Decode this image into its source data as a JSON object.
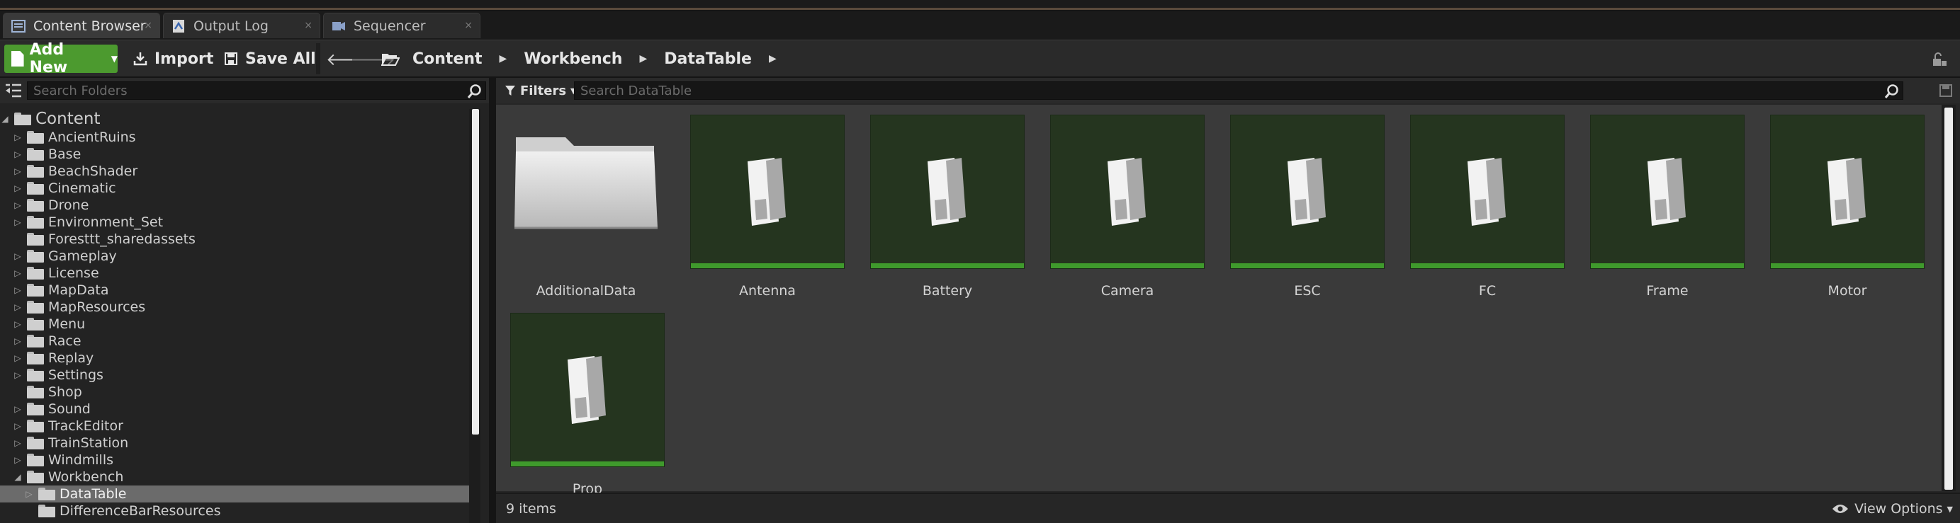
{
  "tabs": [
    {
      "label": "Content Browser",
      "active": true,
      "icon": "content-browser-icon"
    },
    {
      "label": "Output Log",
      "active": false,
      "icon": "output-log-icon"
    },
    {
      "label": "Sequencer",
      "active": false,
      "icon": "sequencer-icon"
    }
  ],
  "toolbar": {
    "add_new_label": "Add New",
    "import_label": "Import",
    "save_all_label": "Save All"
  },
  "breadcrumbs": [
    "Content",
    "Workbench",
    "DataTable"
  ],
  "folder_search": {
    "placeholder": "Search Folders"
  },
  "tree": {
    "root": "Content",
    "items": [
      {
        "label": "AncientRuins",
        "expandable": true
      },
      {
        "label": "Base",
        "expandable": true
      },
      {
        "label": "BeachShader",
        "expandable": true
      },
      {
        "label": "Cinematic",
        "expandable": true
      },
      {
        "label": "Drone",
        "expandable": true
      },
      {
        "label": "Environment_Set",
        "expandable": true
      },
      {
        "label": "Foresttt_sharedassets",
        "expandable": false
      },
      {
        "label": "Gameplay",
        "expandable": true
      },
      {
        "label": "License",
        "expandable": true
      },
      {
        "label": "MapData",
        "expandable": true
      },
      {
        "label": "MapResources",
        "expandable": true
      },
      {
        "label": "Menu",
        "expandable": true
      },
      {
        "label": "Race",
        "expandable": true
      },
      {
        "label": "Replay",
        "expandable": true
      },
      {
        "label": "Settings",
        "expandable": true
      },
      {
        "label": "Shop",
        "expandable": false
      },
      {
        "label": "Sound",
        "expandable": true
      },
      {
        "label": "TrackEditor",
        "expandable": true
      },
      {
        "label": "TrainStation",
        "expandable": true
      },
      {
        "label": "Windmills",
        "expandable": true
      },
      {
        "label": "Workbench",
        "expandable": true,
        "expanded": true
      }
    ],
    "children": [
      {
        "label": "DataTable",
        "expandable": true,
        "selected": true
      },
      {
        "label": "DifferenceBarResources",
        "expandable": false
      }
    ]
  },
  "filters_label": "Filters",
  "asset_search": {
    "placeholder": "Search DataTable"
  },
  "assets": [
    {
      "label": "AdditionalData",
      "kind": "folder"
    },
    {
      "label": "Antenna",
      "kind": "datatable"
    },
    {
      "label": "Battery",
      "kind": "datatable"
    },
    {
      "label": "Camera",
      "kind": "datatable"
    },
    {
      "label": "ESC",
      "kind": "datatable"
    },
    {
      "label": "FC",
      "kind": "datatable"
    },
    {
      "label": "Frame",
      "kind": "datatable"
    },
    {
      "label": "Motor",
      "kind": "datatable"
    },
    {
      "label": "Prop",
      "kind": "datatable"
    }
  ],
  "status": {
    "item_count": "9 items",
    "view_options_label": "View Options"
  },
  "colors": {
    "add_new_green": "#4c9a2f",
    "datatable_tile_bg": "#25351f",
    "datatable_strip": "#3f9a2c"
  }
}
